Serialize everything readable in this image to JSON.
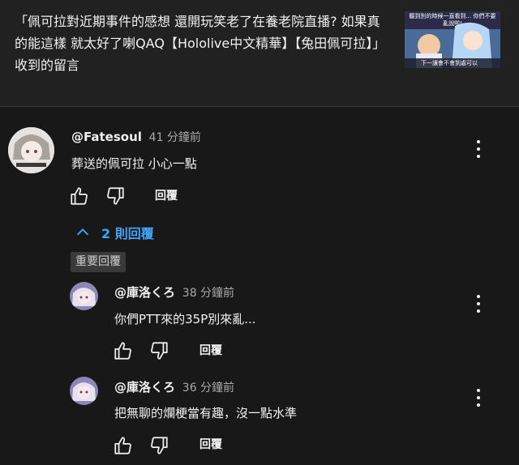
{
  "video": {
    "title": "「佩可拉對近期事件的感想 還開玩笑老了在養老院直播? 如果真的能這樣 就太好了喇QAQ【Hololive中文精華】【兔田佩可拉】」收到的留言",
    "thumbnail_caption_top": "聽到別的時候一直看到... 你們不要亂說啦!",
    "thumbnail_caption_bottom": "下一讓會不會到處可以"
  },
  "comments": [
    {
      "author": "@Fatesoul",
      "time": "41 分鐘前",
      "text": "葬送的佩可拉 小心一點",
      "reply_label": "回覆",
      "replies_toggle": "2 則回覆",
      "sort_chip": "重要回覆"
    }
  ],
  "replies": [
    {
      "author": "@庫洛くろ",
      "time": "38 分鐘前",
      "text": "你們PTT來的35P別來亂...",
      "reply_label": "回覆"
    },
    {
      "author": "@庫洛くろ",
      "time": "36 分鐘前",
      "text": "把無聊的爛梗當有趣，沒一點水準",
      "reply_label": "回覆"
    }
  ],
  "icons": [
    "like-icon",
    "dislike-icon",
    "chevron-up-icon",
    "more-vert-icon"
  ],
  "colors": {
    "background": "#181818",
    "header": "#212121",
    "link": "#3ea6ff",
    "secondary_text": "#aaaaaa"
  }
}
